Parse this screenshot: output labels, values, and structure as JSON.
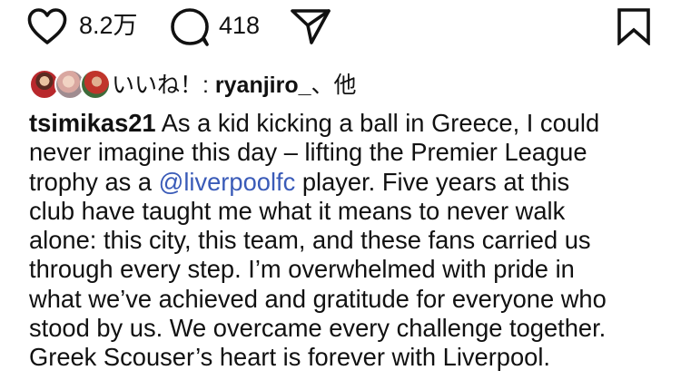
{
  "actions": {
    "like_icon": "heart-outline",
    "like_count": "8.2万",
    "comment_icon": "speech-bubble-outline",
    "comment_count": "418",
    "share_icon": "paper-plane-outline",
    "save_icon": "bookmark-outline"
  },
  "likes": {
    "prefix": "いいね！: ",
    "user": "ryanjiro_",
    "suffix": "、他"
  },
  "caption": {
    "username": "tsimikas21",
    "lines": [
      " As a kid kicking a ball in Greece, I could",
      "never imagine this day – lifting the Premier League",
      "trophy as a ",
      "club have taught me what it means to never walk",
      "alone: this city, this team, and these fans carried us",
      "through every step. I’m overwhelmed with pride in",
      "what we’ve achieved and gratitude for everyone who",
      "stood by us. We overcame every challenge together.",
      "Greek Scouser’s heart is forever with Liverpool."
    ],
    "mention": "@liverpoolfc",
    "line3_tail": " player. Five years at this"
  },
  "colors": {
    "text": "#111111",
    "link": "#3a5bb8",
    "background": "#ffffff"
  }
}
